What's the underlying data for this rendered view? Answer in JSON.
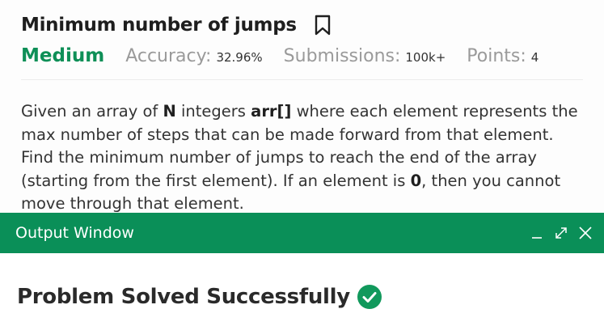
{
  "problem": {
    "title": "Minimum number of jumps",
    "bookmark_icon": "bookmark-icon",
    "difficulty": "Medium",
    "accuracy_label": "Accuracy:",
    "accuracy_value": "32.96%",
    "submissions_label": "Submissions:",
    "submissions_value": "100k+",
    "points_label": "Points:",
    "points_value": "4",
    "description": {
      "t1": "Given an array of ",
      "b1": "N",
      "t2": " integers ",
      "b2": "arr[]",
      "t3": " where each element represents the max number of steps that can be made forward from that element. Find the minimum number of jumps to reach the end of the array (starting from the first element). If an element is ",
      "b3": "0",
      "t4": ", then you cannot move through that element."
    }
  },
  "output_window": {
    "title": "Output Window",
    "minimize_icon": "minimize-icon",
    "expand_icon": "expand-icon",
    "close_icon": "close-icon",
    "result_text": "Problem Solved Successfully",
    "result_icon": "check-circle-icon"
  },
  "colors": {
    "accent_green": "#0a8f58",
    "difficulty_green": "#0e8f57",
    "muted_gray": "#9a9a9a"
  }
}
